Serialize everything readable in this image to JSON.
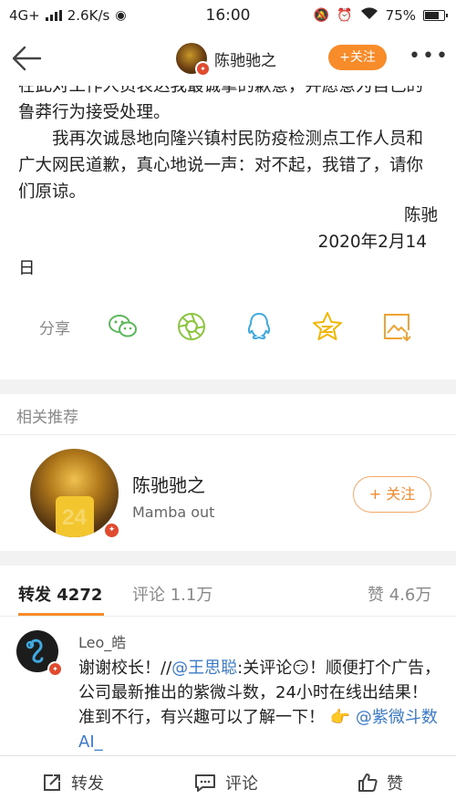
{
  "status_bar": {
    "network": "4G+",
    "speed": "2.6K/s",
    "time": "16:00",
    "battery": "75%"
  },
  "header": {
    "name": "陈驰驰之",
    "follow_label": "+关注",
    "more_label": "•••"
  },
  "article": {
    "para_top": "在此对工作人员表达我最诚挚的歉意，并愿意为自己的鲁莽行为接受处理。",
    "para_main": "我再次诚恳地向隆兴镇村民防疫检测点工作人员和广大网民道歉，真心地说一声：对不起，我错了，请你们原谅。",
    "signature": "陈驰",
    "date": "2020年2月14",
    "date_tail": "日"
  },
  "share": {
    "label": "分享",
    "targets": [
      "wechat-icon",
      "moments-icon",
      "qq-icon",
      "qzone-icon",
      "save-image-icon"
    ]
  },
  "related": {
    "title": "相关推荐",
    "name": "陈驰驰之",
    "bio": "Mamba out",
    "follow_label": "+ 关注",
    "jersey_number": "24"
  },
  "tabs": {
    "repost": "转发 4272",
    "comment": "评论 1.1万",
    "like": "赞 4.6万"
  },
  "comment": {
    "user": "Leo_皓",
    "text_1": "谢谢校长！//",
    "mention_1": "@王思聪",
    "text_2": ":关评论😏！顺便打个广告，公司最新推出的紫微斗数，24小时在线出结果！准到不行，有兴趣可以了解一下！ 👉 ",
    "mention_2": "@紫微斗数AI_"
  },
  "bottom_bar": {
    "repost": "转发",
    "comment": "评论",
    "like": "赞"
  },
  "colors": {
    "accent_orange": "#f98c2a",
    "link_blue": "#3b7bc8",
    "verified_red": "#e04a2f"
  }
}
